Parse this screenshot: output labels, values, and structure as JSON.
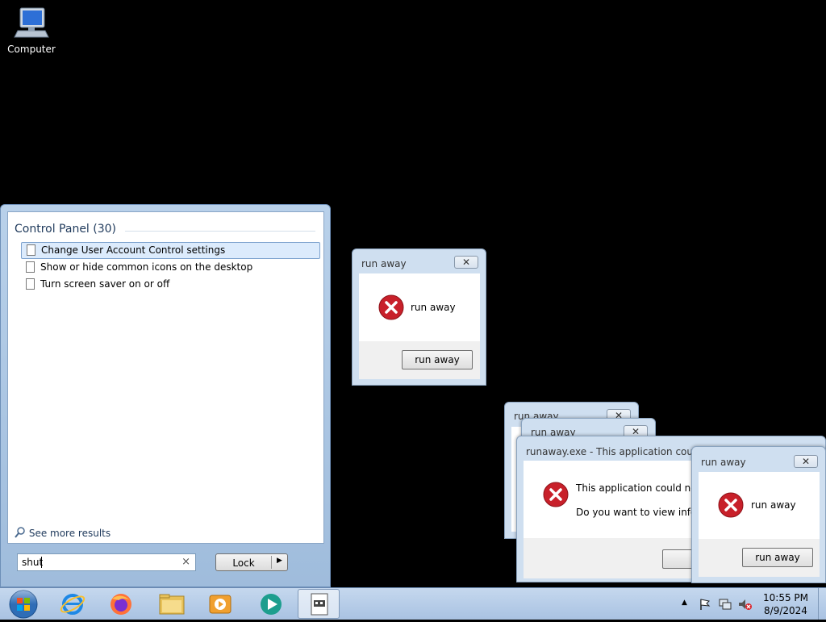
{
  "desktop": {
    "icons": [
      {
        "label": "Computer",
        "icon": "computer-icon"
      }
    ]
  },
  "start_menu": {
    "section_header": "Control Panel (30)",
    "results": [
      {
        "label": "Change User Account Control settings",
        "selected": true
      },
      {
        "label": "Show or hide common icons on the desktop",
        "selected": false
      },
      {
        "label": "Turn screen saver on or off",
        "selected": false
      }
    ],
    "see_more": "See more results",
    "search_value": "shut",
    "clear_glyph": "×",
    "lock_label": "Lock",
    "lock_arrow": "▶"
  },
  "dialogs": {
    "main": {
      "title": "run away",
      "message": "run away",
      "button": "run away",
      "close": "✕"
    },
    "back1": {
      "title": "run away",
      "close": "✕"
    },
    "back2": {
      "title": "run away",
      "close": "✕"
    },
    "error": {
      "title": "runaway.exe - This application could no",
      "line1": "This application could not b",
      "line2": "Do you want to view inform"
    },
    "front": {
      "title": "run away",
      "message": "run away",
      "button": "run away",
      "close": "✕"
    }
  },
  "taskbar": {
    "items": [
      {
        "name": "start-orb",
        "icon": "windows-orb-icon"
      },
      {
        "name": "internet-explorer",
        "icon": "internet-explorer-icon"
      },
      {
        "name": "firefox",
        "icon": "firefox-icon"
      },
      {
        "name": "file-explorer",
        "icon": "folder-icon"
      },
      {
        "name": "media-player",
        "icon": "media-player-icon"
      },
      {
        "name": "app",
        "icon": "app-icon"
      },
      {
        "name": "runaway",
        "icon": "runaway-icon",
        "active": true
      }
    ],
    "clock_time": "10:55 PM",
    "clock_date": "8/9/2024"
  },
  "colors": {
    "desktop": "#000000",
    "error_red": "#c8202a",
    "accent": "#7da2ce"
  }
}
